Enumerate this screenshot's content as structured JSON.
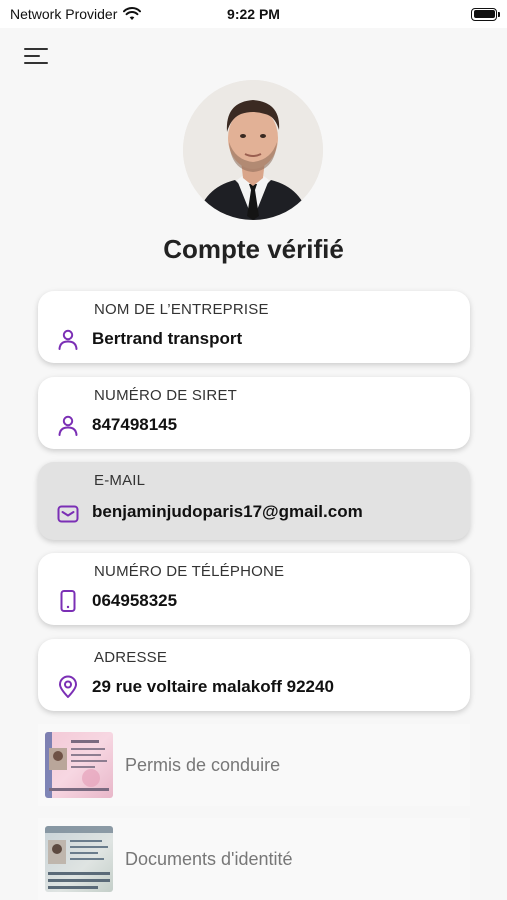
{
  "status_bar": {
    "carrier": "Network Provider",
    "time": "9:22 PM",
    "battery_level": 1.0
  },
  "header": {
    "menu_icon": "hamburger-menu-icon"
  },
  "profile": {
    "title": "Compte vérifié"
  },
  "fields": [
    {
      "label": "NOM DE L’ENTREPRISE",
      "value": "Bertrand transport",
      "icon": "person-icon"
    },
    {
      "label": "NUMÉRO DE SIRET",
      "value": "847498145",
      "icon": "person-icon"
    },
    {
      "label": "E-MAIL",
      "value": "benjaminjudoparis17@gmail.com",
      "icon": "mail-icon"
    },
    {
      "label": "NUMÉRO DE TÉLÉPHONE",
      "value": "064958325",
      "icon": "phone-icon"
    },
    {
      "label": "ADRESSE",
      "value": "29 rue voltaire malakoff 92240",
      "icon": "location-pin-icon"
    }
  ],
  "documents": [
    {
      "label": "Permis de conduire",
      "icon": "driving-license-thumbnail"
    },
    {
      "label": "Documents d'identité",
      "icon": "identity-card-thumbnail"
    }
  ],
  "colors": {
    "accent": "#7b2fb5",
    "card_background": "#ffffff",
    "active_card_background": "#e2e2e2",
    "page_background": "#f7f7f7"
  }
}
